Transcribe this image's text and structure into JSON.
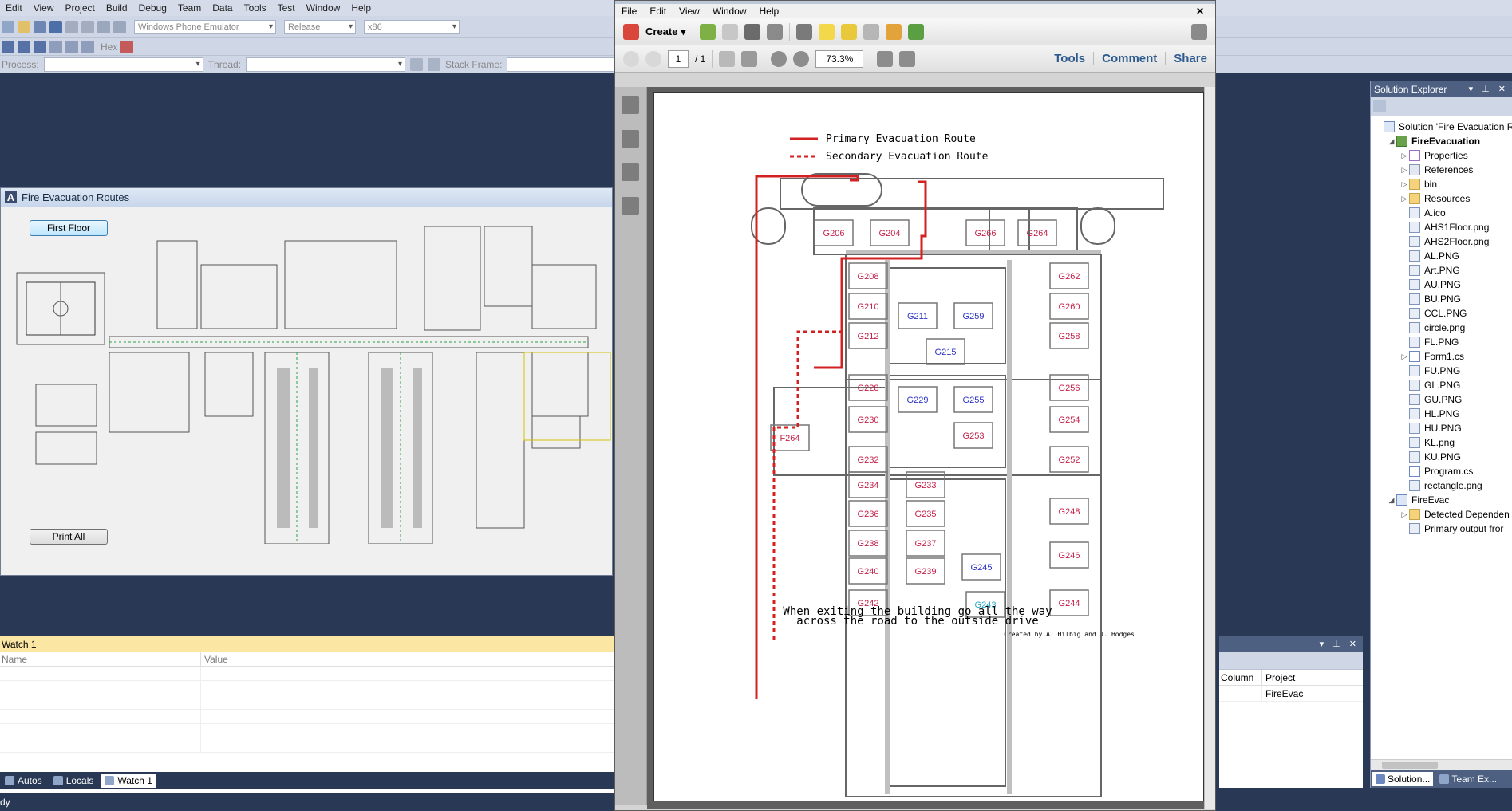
{
  "vs": {
    "menu": [
      "Edit",
      "View",
      "Project",
      "Build",
      "Debug",
      "Team",
      "Data",
      "Tools",
      "Test",
      "Window",
      "Help"
    ],
    "toolbar": {
      "platform": "Windows Phone Emulator",
      "config": "Release",
      "arch": "x86",
      "hex_label": "Hex"
    },
    "debug_bar": {
      "process_label": "Process:",
      "thread_label": "Thread:",
      "stack_label": "Stack Frame:"
    },
    "status": "dy"
  },
  "form": {
    "title": "Fire Evacuation Routes",
    "first_floor_button": "First Floor",
    "print_all_button": "Print All"
  },
  "acrobat": {
    "menu": [
      "File",
      "Edit",
      "View",
      "Window",
      "Help"
    ],
    "create_label": "Create",
    "page_current": "1",
    "page_total": "/ 1",
    "zoom": "73.3%",
    "panes": [
      "Tools",
      "Comment",
      "Share"
    ]
  },
  "map": {
    "legend_primary": "Primary Evacuation Route",
    "legend_secondary": "Secondary Evacuation Route",
    "footer1": "When exiting the building go all the way",
    "footer2": "across the road to the outside drive",
    "credit": "Created by A. Hilbig and J. Hodges",
    "rooms": [
      {
        "id": "G206",
        "c": "red"
      },
      {
        "id": "G204",
        "c": "red"
      },
      {
        "id": "G266",
        "c": "red"
      },
      {
        "id": "G264",
        "c": "red"
      },
      {
        "id": "G208",
        "c": "red"
      },
      {
        "id": "G262",
        "c": "red"
      },
      {
        "id": "G210",
        "c": "red"
      },
      {
        "id": "G211",
        "c": "blue"
      },
      {
        "id": "G259",
        "c": "blue"
      },
      {
        "id": "G260",
        "c": "red"
      },
      {
        "id": "G212",
        "c": "red"
      },
      {
        "id": "G258",
        "c": "red"
      },
      {
        "id": "G215",
        "c": "blue"
      },
      {
        "id": "G228",
        "c": "red"
      },
      {
        "id": "G256",
        "c": "red"
      },
      {
        "id": "G229",
        "c": "blue"
      },
      {
        "id": "G255",
        "c": "blue"
      },
      {
        "id": "G230",
        "c": "red"
      },
      {
        "id": "G254",
        "c": "red"
      },
      {
        "id": "G253",
        "c": "red"
      },
      {
        "id": "F264",
        "c": "red"
      },
      {
        "id": "G232",
        "c": "red"
      },
      {
        "id": "G252",
        "c": "red"
      },
      {
        "id": "G234",
        "c": "red"
      },
      {
        "id": "G233",
        "c": "red"
      },
      {
        "id": "G236",
        "c": "red"
      },
      {
        "id": "G235",
        "c": "red"
      },
      {
        "id": "G248",
        "c": "red"
      },
      {
        "id": "G238",
        "c": "red"
      },
      {
        "id": "G237",
        "c": "red"
      },
      {
        "id": "G240",
        "c": "red"
      },
      {
        "id": "G239",
        "c": "red"
      },
      {
        "id": "G245",
        "c": "blue"
      },
      {
        "id": "G246",
        "c": "red"
      },
      {
        "id": "G242",
        "c": "red"
      },
      {
        "id": "G243",
        "c": "cyan"
      },
      {
        "id": "G244",
        "c": "red"
      }
    ]
  },
  "watch": {
    "title": "Watch 1",
    "col_name": "Name",
    "col_value": "Value",
    "tabs": [
      "Autos",
      "Locals",
      "Watch 1"
    ]
  },
  "errors": {
    "col_column": "Column",
    "col_project": "Project",
    "row_project": "FireEvac"
  },
  "solution": {
    "title": "Solution Explorer",
    "items": [
      {
        "label": "Solution 'Fire Evacuation R",
        "indent": 0,
        "icon": "sln",
        "exp": ""
      },
      {
        "label": "FireEvacuation",
        "indent": 1,
        "icon": "proj",
        "exp": "◢",
        "bold": true
      },
      {
        "label": "Properties",
        "indent": 2,
        "icon": "props",
        "exp": "▷"
      },
      {
        "label": "References",
        "indent": 2,
        "icon": "refs",
        "exp": "▷"
      },
      {
        "label": "bin",
        "indent": 2,
        "icon": "folder",
        "exp": "▷"
      },
      {
        "label": "Resources",
        "indent": 2,
        "icon": "folder",
        "exp": "▷"
      },
      {
        "label": "A.ico",
        "indent": 2,
        "icon": "img",
        "exp": ""
      },
      {
        "label": "AHS1Floor.png",
        "indent": 2,
        "icon": "img",
        "exp": ""
      },
      {
        "label": "AHS2Floor.png",
        "indent": 2,
        "icon": "img",
        "exp": ""
      },
      {
        "label": "AL.PNG",
        "indent": 2,
        "icon": "img",
        "exp": ""
      },
      {
        "label": "Art.PNG",
        "indent": 2,
        "icon": "img",
        "exp": ""
      },
      {
        "label": "AU.PNG",
        "indent": 2,
        "icon": "img",
        "exp": ""
      },
      {
        "label": "BU.PNG",
        "indent": 2,
        "icon": "img",
        "exp": ""
      },
      {
        "label": "CCL.PNG",
        "indent": 2,
        "icon": "img",
        "exp": ""
      },
      {
        "label": "circle.png",
        "indent": 2,
        "icon": "img",
        "exp": ""
      },
      {
        "label": "FL.PNG",
        "indent": 2,
        "icon": "img",
        "exp": ""
      },
      {
        "label": "Form1.cs",
        "indent": 2,
        "icon": "cs",
        "exp": "▷"
      },
      {
        "label": "FU.PNG",
        "indent": 2,
        "icon": "img",
        "exp": ""
      },
      {
        "label": "GL.PNG",
        "indent": 2,
        "icon": "img",
        "exp": ""
      },
      {
        "label": "GU.PNG",
        "indent": 2,
        "icon": "img",
        "exp": ""
      },
      {
        "label": "HL.PNG",
        "indent": 2,
        "icon": "img",
        "exp": ""
      },
      {
        "label": "HU.PNG",
        "indent": 2,
        "icon": "img",
        "exp": ""
      },
      {
        "label": "KL.png",
        "indent": 2,
        "icon": "img",
        "exp": ""
      },
      {
        "label": "KU.PNG",
        "indent": 2,
        "icon": "img",
        "exp": ""
      },
      {
        "label": "Program.cs",
        "indent": 2,
        "icon": "cs",
        "exp": ""
      },
      {
        "label": "rectangle.png",
        "indent": 2,
        "icon": "img",
        "exp": ""
      },
      {
        "label": "FireEvac",
        "indent": 1,
        "icon": "sln",
        "exp": "◢"
      },
      {
        "label": "Detected Dependen",
        "indent": 2,
        "icon": "folder",
        "exp": "▷"
      },
      {
        "label": "Primary output fror",
        "indent": 2,
        "icon": "img",
        "exp": ""
      }
    ],
    "tabs": [
      "Solution...",
      "Team Ex..."
    ]
  }
}
